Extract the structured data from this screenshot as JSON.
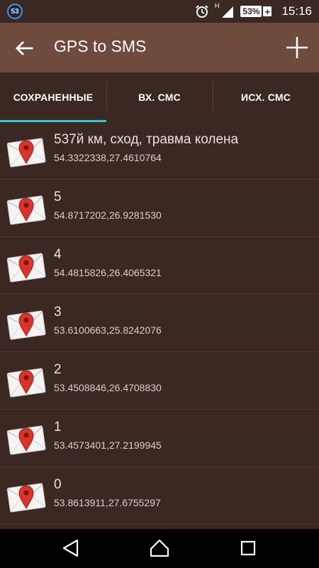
{
  "status": {
    "notification_count": "53",
    "network_type": "H",
    "battery": "53%",
    "battery_charging": "+",
    "time": "15:16"
  },
  "appbar": {
    "title": "GPS to SMS"
  },
  "tabs": [
    {
      "label": "СОХРАНЕННЫЕ",
      "active": true
    },
    {
      "label": "ВХ. СМС",
      "active": false
    },
    {
      "label": "ИСХ. СМС",
      "active": false
    }
  ],
  "items": [
    {
      "title": "537й км, сход, травма колена",
      "coords": "54.3322338,27.4610764"
    },
    {
      "title": "5",
      "coords": "54.8717202,26.9281530"
    },
    {
      "title": "4",
      "coords": "54.4815826,26.4065321"
    },
    {
      "title": "3",
      "coords": "53.6100663,25.8242076"
    },
    {
      "title": "2",
      "coords": "53.4508846,26.4708830"
    },
    {
      "title": "1",
      "coords": "53.4573401,27.2199945"
    },
    {
      "title": "0",
      "coords": "53.8613911,27.6755297"
    }
  ],
  "colors": {
    "status_bar": "#3b2823",
    "app_bar": "#6e4b3c",
    "list_bg": "#3b2823",
    "tab_indicator": "#33c7d6",
    "pin": "#d9342b"
  },
  "icons": {
    "back": "arrow-left-icon",
    "add": "plus-icon",
    "row": "envelope-map-pin-icon",
    "nav": [
      "back-triangle-icon",
      "home-icon",
      "recents-square-icon"
    ]
  }
}
